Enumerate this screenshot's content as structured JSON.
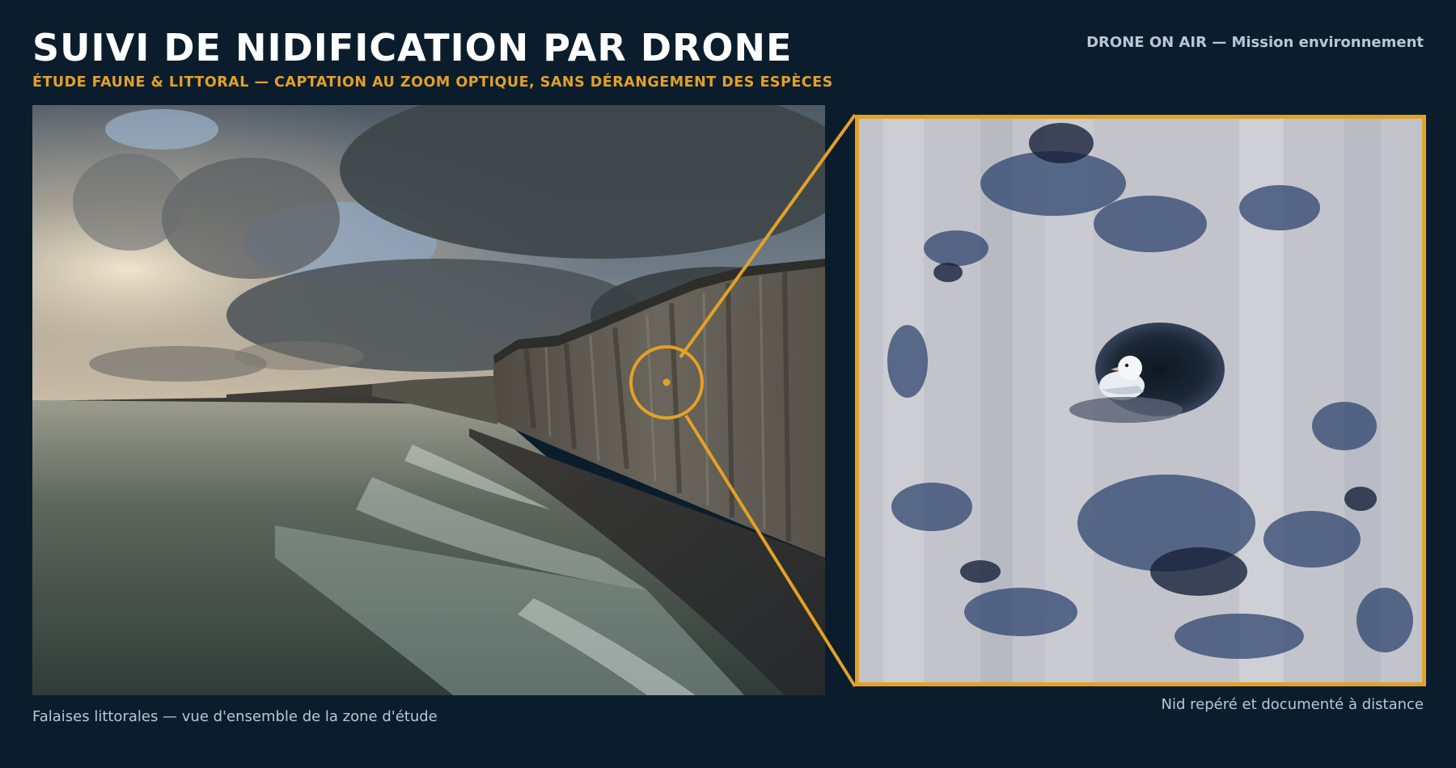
{
  "header": {
    "title": "SUIVI DE NIDIFICATION PAR DRONE",
    "subtitle": "ÉTUDE FAUNE & LITTORAL — CAPTATION AU ZOOM OPTIQUE, SANS DÉRANGEMENT DES ESPÈCES",
    "brand": "DRONE ON AIR — Mission environnement"
  },
  "captions": {
    "overview": "Falaises littorales — vue d'ensemble de la zone d'étude",
    "detail": "Nid repéré et documenté à distance"
  },
  "colors": {
    "background": "#0b1d2d",
    "accent": "#e3a126",
    "muted_text": "#b9c7d4"
  },
  "icons": {
    "focus_marker": "target-circle-icon"
  }
}
